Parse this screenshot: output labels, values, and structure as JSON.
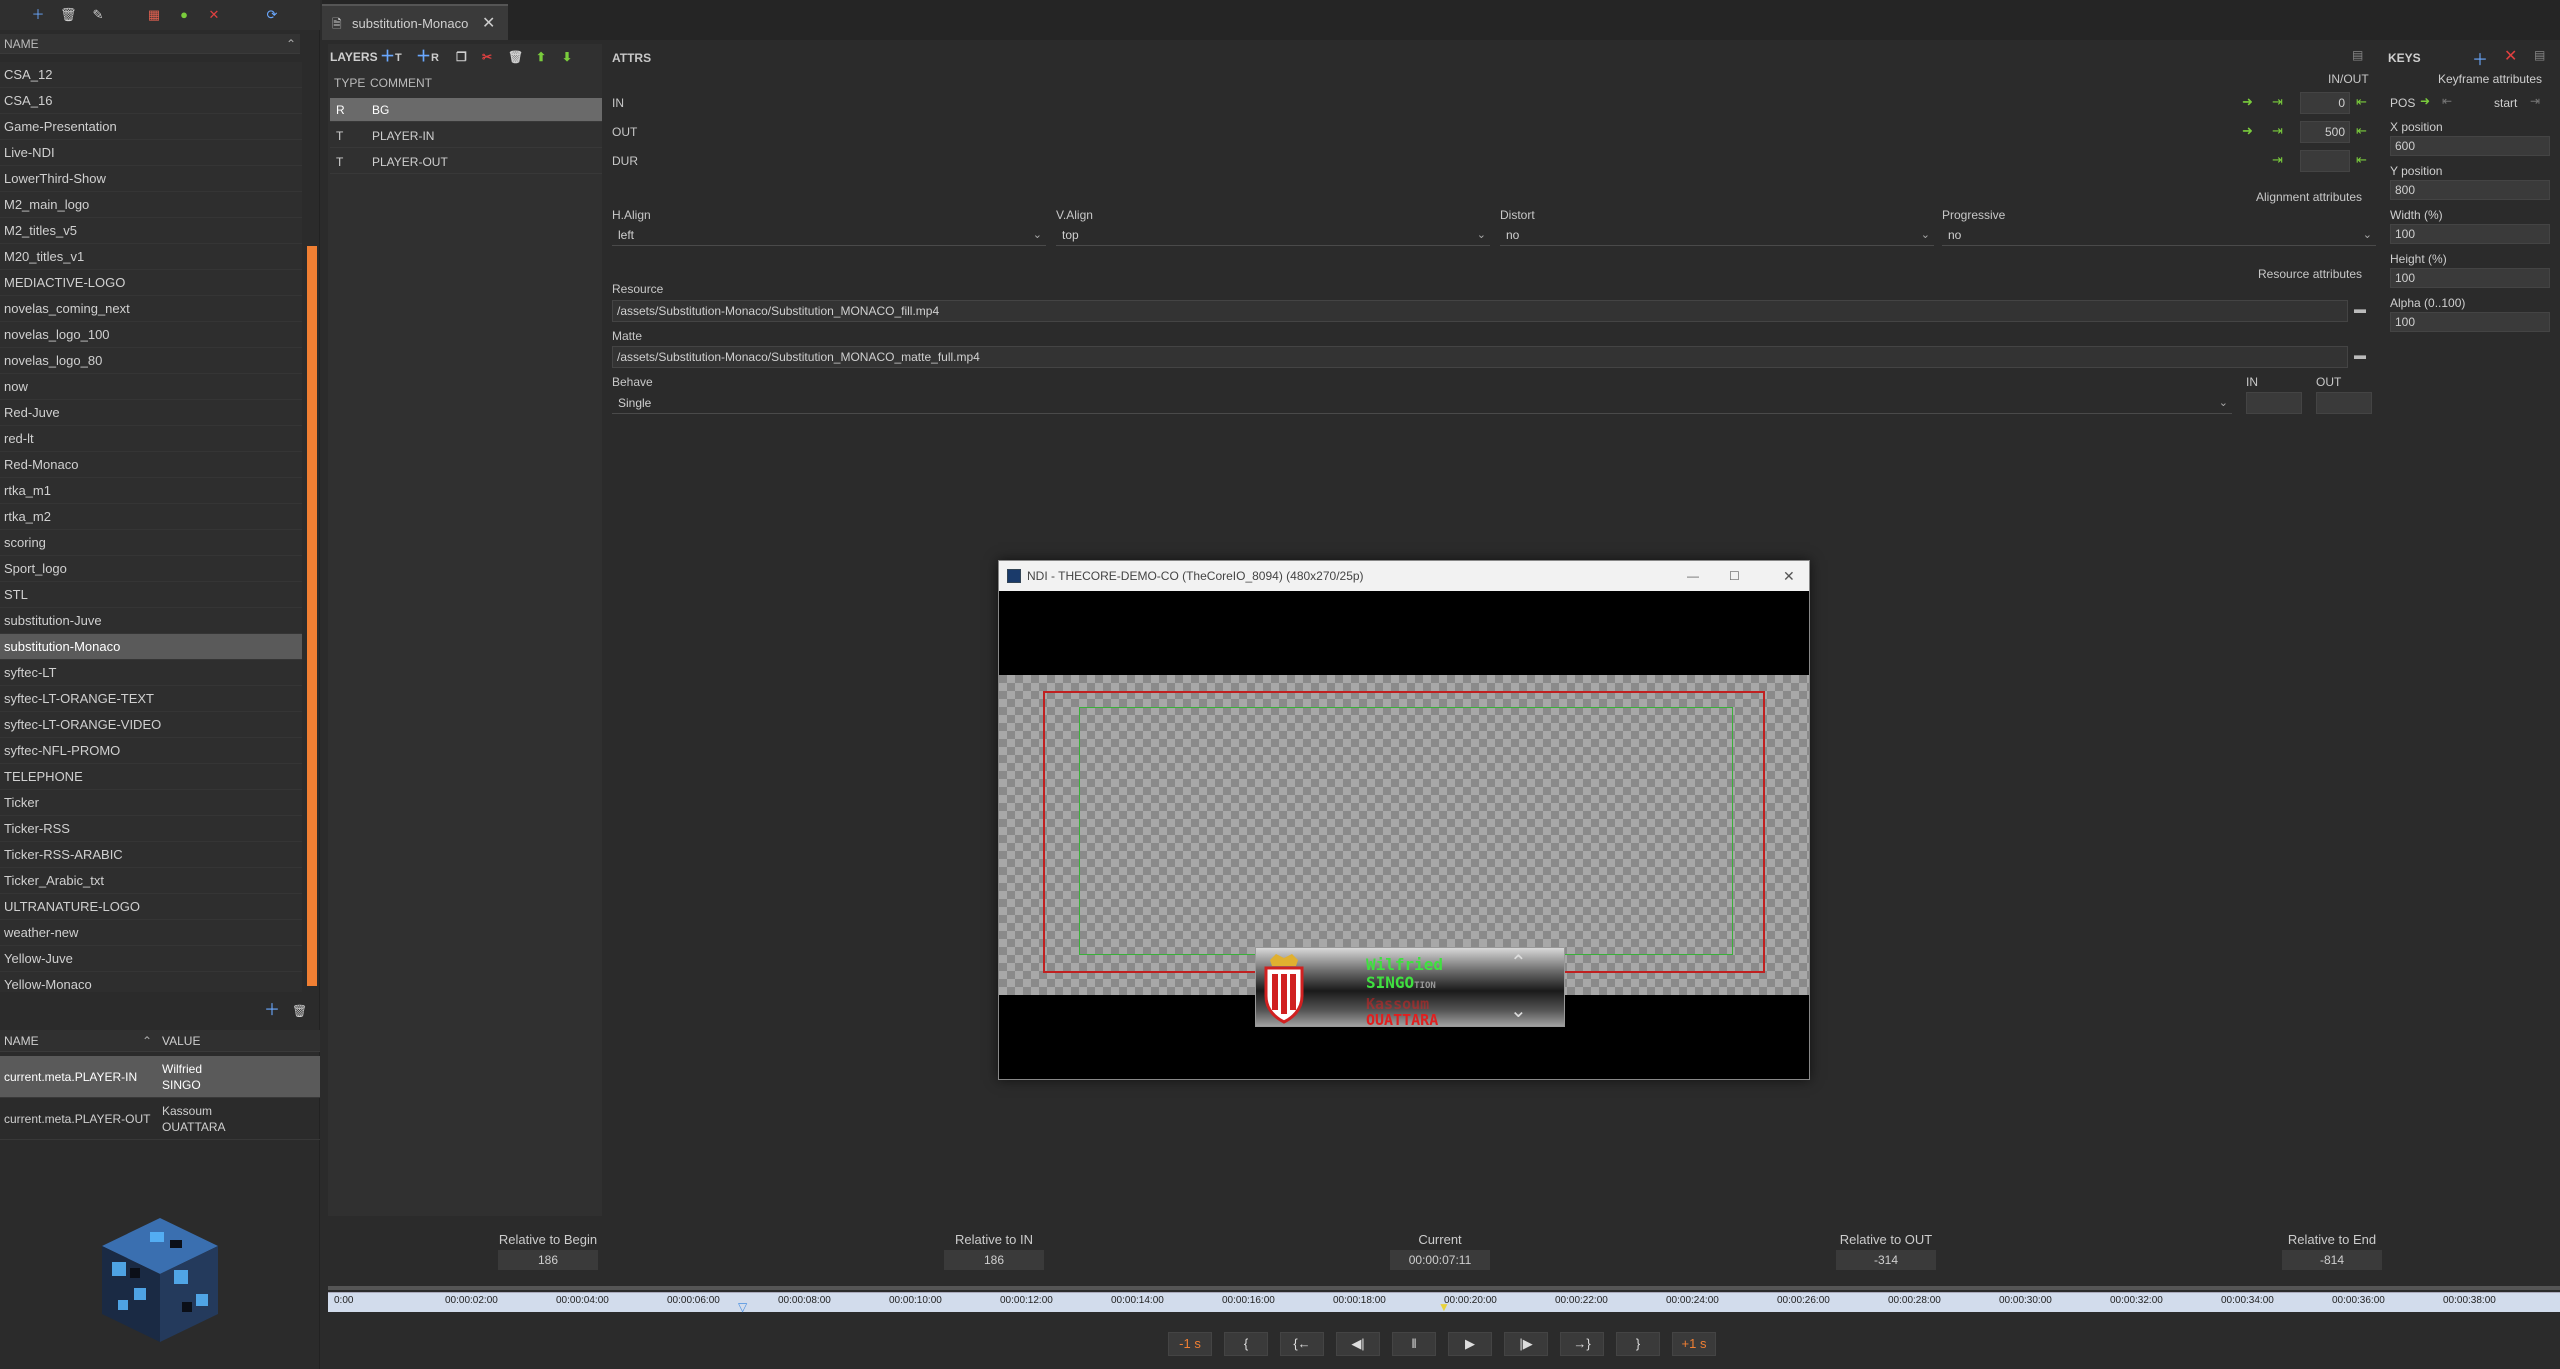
{
  "left": {
    "name_header": "NAME",
    "items": [
      "CSA_12",
      "CSA_16",
      "Game-Presentation",
      "Live-NDI",
      "LowerThird-Show",
      "M2_main_logo",
      "M2_titles_v5",
      "M20_titles_v1",
      "MEDIACTIVE-LOGO",
      "novelas_coming_next",
      "novelas_logo_100",
      "novelas_logo_80",
      "now",
      "Red-Juve",
      "red-lt",
      "Red-Monaco",
      "rtka_m1",
      "rtka_m2",
      "scoring",
      "Sport_logo",
      "STL",
      "substitution-Juve",
      "substitution-Monaco",
      "syftec-LT",
      "syftec-LT-ORANGE-TEXT",
      "syftec-LT-ORANGE-VIDEO",
      "syftec-NFL-PROMO",
      "TELEPHONE",
      "Ticker",
      "Ticker-RSS",
      "Ticker-RSS-ARABIC",
      "Ticker_Arabic_txt",
      "ULTRANATURE-LOGO",
      "weather-new",
      "Yellow-Juve",
      "Yellow-Monaco"
    ],
    "selected": "substitution-Monaco",
    "meta_header_name": "NAME",
    "meta_header_value": "VALUE",
    "meta": [
      {
        "key": "current.meta.PLAYER-IN",
        "value1": "Wilfried",
        "value2": "SINGO"
      },
      {
        "key": "current.meta.PLAYER-OUT",
        "value1": "Kassoum",
        "value2": "OUATTARA"
      }
    ]
  },
  "tab": {
    "label": "substitution-Monaco"
  },
  "layers": {
    "title": "LAYERS",
    "add_t": "T",
    "add_r": "R",
    "col_type": "TYPE",
    "col_comment": "COMMENT",
    "rows": [
      {
        "type": "R",
        "comment": "BG"
      },
      {
        "type": "T",
        "comment": "PLAYER-IN"
      },
      {
        "type": "T",
        "comment": "PLAYER-OUT"
      }
    ]
  },
  "attrs": {
    "title": "ATTRS",
    "inout_label": "IN/OUT",
    "in_label": "IN",
    "out_label": "OUT",
    "dur_label": "DUR",
    "in_value": "0",
    "out_value": "500",
    "dur_value": "",
    "alignment_title": "Alignment attributes",
    "halign_label": "H.Align",
    "halign_value": "left",
    "valign_label": "V.Align",
    "valign_value": "top",
    "distort_label": "Distort",
    "distort_value": "no",
    "progressive_label": "Progressive",
    "progressive_value": "no",
    "resource_title": "Resource attributes",
    "resource_label": "Resource",
    "resource_value": "/assets/Substitution-Monaco/Substitution_MONACO_fill.mp4",
    "matte_label": "Matte",
    "matte_value": "/assets/Substitution-Monaco/Substitution_MONACO_matte_full.mp4",
    "behave_label": "Behave",
    "behave_value": "Single",
    "behave_in": "IN",
    "behave_out": "OUT"
  },
  "keys": {
    "title": "KEYS",
    "keyframe_title": "Keyframe attributes",
    "pos_label": "POS",
    "start_label": "start",
    "x_label": "X position",
    "x_value": "600",
    "y_label": "Y position",
    "y_value": "800",
    "w_label": "Width (%)",
    "w_value": "100",
    "h_label": "Height (%)",
    "h_value": "100",
    "a_label": "Alpha (0..100)",
    "a_value": "100"
  },
  "ndi": {
    "title": "NDI - THECORE-DEMO-CO (TheCoreIO_8094) (480x270/25p)",
    "player_in_1": "Wilfried",
    "player_in_2": "SINGO",
    "player_in_suffix": "TION",
    "player_out_1": "Kassoum",
    "player_out_2": "OUATTARA"
  },
  "timecodes": [
    {
      "label": "Relative to Begin",
      "value": "186"
    },
    {
      "label": "Relative to IN",
      "value": "186"
    },
    {
      "label": "Current",
      "value": "00:00:07:11"
    },
    {
      "label": "Relative to OUT",
      "value": "-314"
    },
    {
      "label": "Relative to End",
      "value": "-814"
    }
  ],
  "ruler_ticks": [
    "0:00",
    "00:00:02:00",
    "00:00:04:00",
    "00:00:06:00",
    "00:00:08:00",
    "00:00:10:00",
    "00:00:12:00",
    "00:00:14:00",
    "00:00:16:00",
    "00:00:18:00",
    "00:00:20:00",
    "00:00:22:00",
    "00:00:24:00",
    "00:00:26:00",
    "00:00:28:00",
    "00:00:30:00",
    "00:00:32:00",
    "00:00:34:00",
    "00:00:36:00",
    "00:00:38:00"
  ],
  "transport": {
    "minus1s": "-1 s",
    "mark_in": "{",
    "goto_in": "{←",
    "step_back": "◀|",
    "pause": "‖",
    "play": "▶",
    "step_fwd": "|▶",
    "goto_out": "→}",
    "mark_out": "}",
    "plus1s": "+1 s"
  },
  "colors": {
    "accent": "#f07f33",
    "selected_row": "#5a5a5a",
    "green_icon": "#7acc3c"
  }
}
